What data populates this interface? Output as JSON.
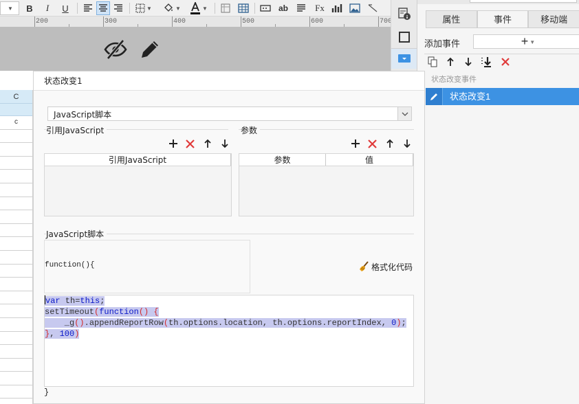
{
  "toolbar": {
    "items": [
      "B",
      "I",
      "U",
      "ab",
      "Fx"
    ],
    "ruler_labels": [
      "200",
      "300",
      "400",
      "500",
      "600",
      "700"
    ]
  },
  "sheet": {
    "column_header": "C",
    "row_label": "c"
  },
  "right_panel": {
    "tabs": [
      "属性",
      "事件",
      "移动端"
    ],
    "add_event_label": "添加事件",
    "add_button": "+",
    "event_group": "状态改变事件",
    "event_item": "状态改变1"
  },
  "dialog": {
    "title": "状态改变1",
    "type_select_value": "JavaScript脚本",
    "ref_js_group": "引用JavaScript",
    "ref_js_column": "引用JavaScript",
    "params_group": "参数",
    "params_columns": [
      "参数",
      "值"
    ],
    "script_group": "JavaScript脚本",
    "function_header": "function(){",
    "format_button": "格式化代码",
    "code_lines": [
      [
        [
          "kw",
          "var"
        ],
        [
          "",
          " th="
        ],
        [
          "kw",
          "this"
        ],
        [
          "",
          ";"
        ]
      ],
      [
        [
          "",
          "setTimeout"
        ],
        [
          "pr",
          "("
        ],
        [
          "kw",
          "function"
        ],
        [
          "pr",
          "() {"
        ]
      ],
      [
        [
          "",
          "    _g"
        ],
        [
          "pr",
          "()"
        ],
        [
          "",
          ".appendReportRow"
        ],
        [
          "pr",
          "("
        ],
        [
          "",
          "th.options.location, th.options.reportIndex, "
        ],
        [
          "num",
          "0"
        ],
        [
          "pr",
          ")"
        ],
        [
          "",
          ";"
        ]
      ],
      [
        [
          "pr",
          "}"
        ],
        [
          "",
          ", "
        ],
        [
          "num",
          "100"
        ],
        [
          "pr",
          ")"
        ]
      ]
    ],
    "function_close": "}"
  },
  "colors": {
    "accent": "#3d92e3",
    "selection": "#c7c9ef",
    "keyword": "#0a18c8",
    "delete_red": "#e03a3a"
  }
}
